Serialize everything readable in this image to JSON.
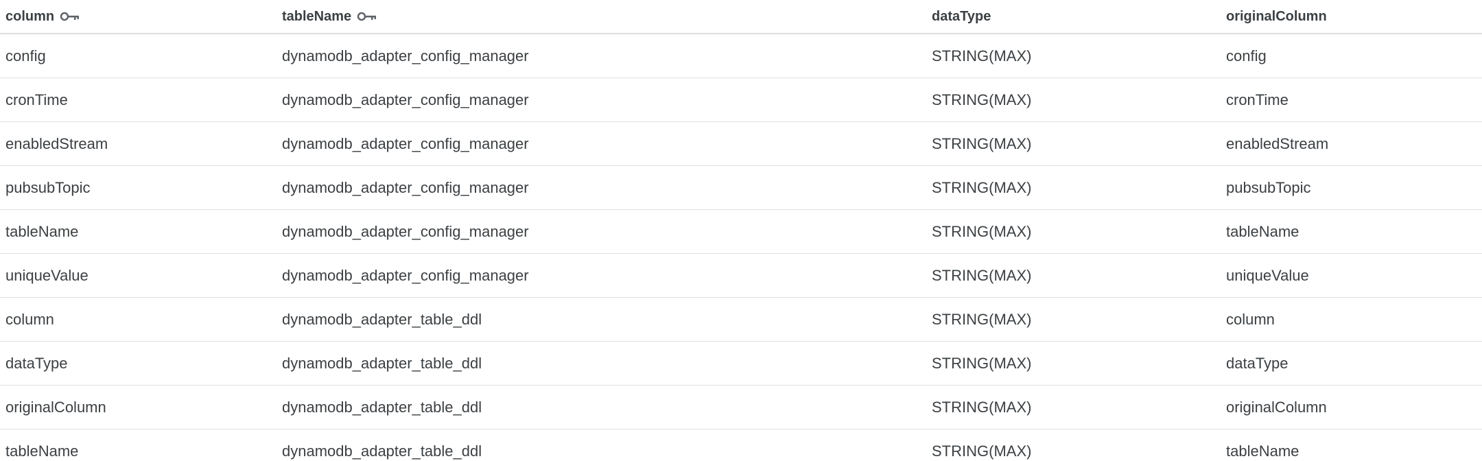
{
  "columns": [
    {
      "label": "column",
      "key_icon": "key-icon"
    },
    {
      "label": "tableName",
      "key_icon": "key-icon"
    },
    {
      "label": "dataType"
    },
    {
      "label": "originalColumn"
    }
  ],
  "rows": [
    [
      "config",
      "dynamodb_adapter_config_manager",
      "STRING(MAX)",
      "config"
    ],
    [
      "cronTime",
      "dynamodb_adapter_config_manager",
      "STRING(MAX)",
      "cronTime"
    ],
    [
      "enabledStream",
      "dynamodb_adapter_config_manager",
      "STRING(MAX)",
      "enabledStream"
    ],
    [
      "pubsubTopic",
      "dynamodb_adapter_config_manager",
      "STRING(MAX)",
      "pubsubTopic"
    ],
    [
      "tableName",
      "dynamodb_adapter_config_manager",
      "STRING(MAX)",
      "tableName"
    ],
    [
      "uniqueValue",
      "dynamodb_adapter_config_manager",
      "STRING(MAX)",
      "uniqueValue"
    ],
    [
      "column",
      "dynamodb_adapter_table_ddl",
      "STRING(MAX)",
      "column"
    ],
    [
      "dataType",
      "dynamodb_adapter_table_ddl",
      "STRING(MAX)",
      "dataType"
    ],
    [
      "originalColumn",
      "dynamodb_adapter_table_ddl",
      "STRING(MAX)",
      "originalColumn"
    ],
    [
      "tableName",
      "dynamodb_adapter_table_ddl",
      "STRING(MAX)",
      "tableName"
    ]
  ],
  "colors": {
    "text": "#3c4043",
    "divider": "#e0e0e0",
    "icon": "#5f6368"
  }
}
